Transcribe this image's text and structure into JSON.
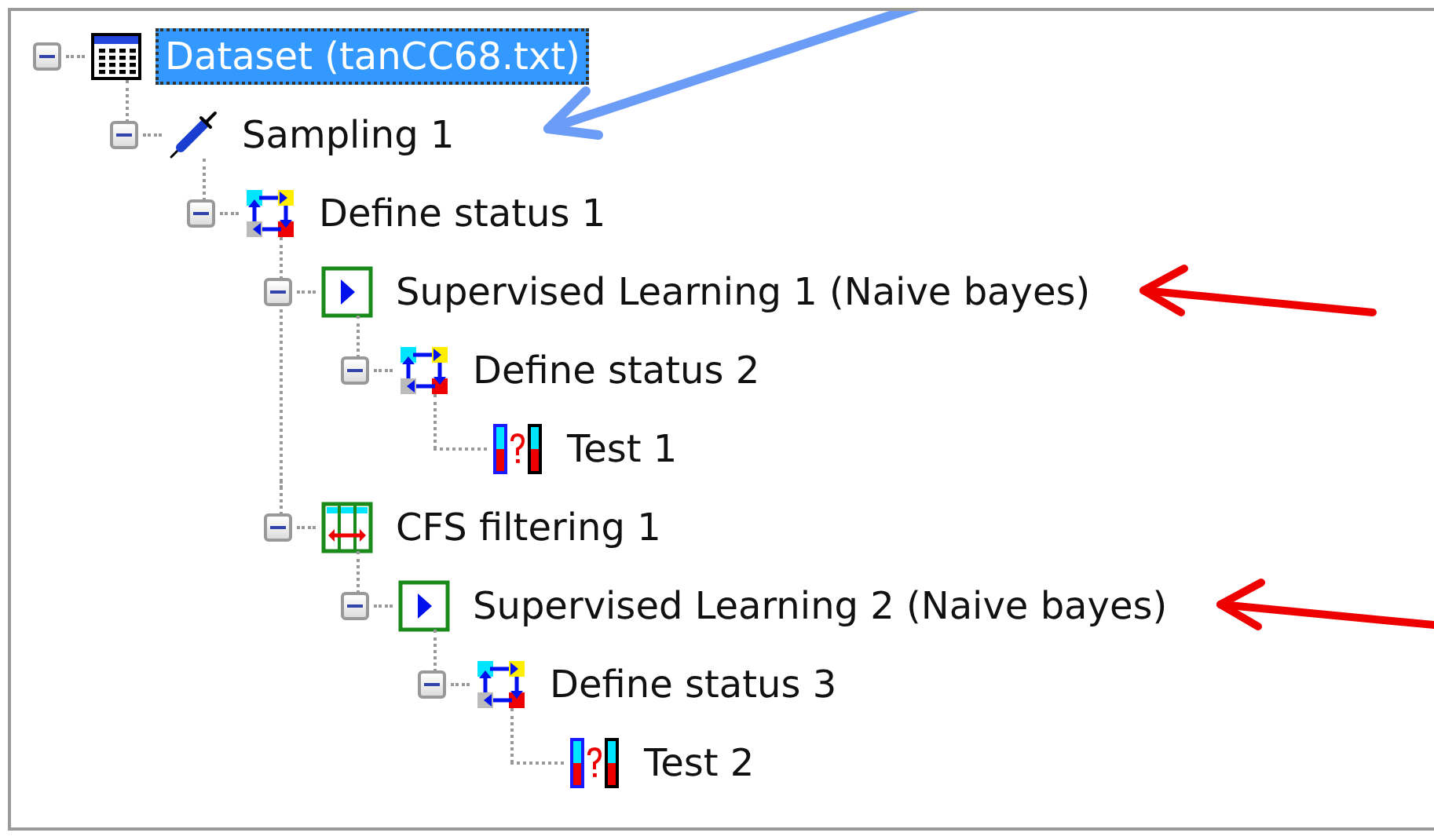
{
  "tree": [
    {
      "label": "Dataset (tanCC68.txt)",
      "kind": "dataset",
      "selected": true,
      "expanded": true,
      "children": [
        {
          "label": "Sampling 1",
          "kind": "sampling",
          "selected": false,
          "expanded": true,
          "pointer": {
            "color": "#6b9cf6",
            "kind": "from-above"
          },
          "children": [
            {
              "label": "Define status 1",
              "kind": "status",
              "selected": false,
              "expanded": true,
              "children": [
                {
                  "label": "Supervised Learning 1 (Naive bayes)",
                  "kind": "learning",
                  "selected": false,
                  "expanded": true,
                  "pointer": {
                    "color": "#ee0000",
                    "kind": "from-right"
                  },
                  "children": [
                    {
                      "label": "Define status 2",
                      "kind": "status",
                      "selected": false,
                      "expanded": true,
                      "children": [
                        {
                          "label": "Test 1",
                          "kind": "test",
                          "selected": false
                        }
                      ]
                    }
                  ]
                },
                {
                  "label": "CFS filtering 1",
                  "kind": "filter",
                  "selected": false,
                  "expanded": true,
                  "children": [
                    {
                      "label": "Supervised Learning 2 (Naive bayes)",
                      "kind": "learning",
                      "selected": false,
                      "expanded": true,
                      "pointer": {
                        "color": "#ee0000",
                        "kind": "from-right"
                      },
                      "children": [
                        {
                          "label": "Define status 3",
                          "kind": "status",
                          "selected": false,
                          "expanded": true,
                          "children": [
                            {
                              "label": "Test 2",
                              "kind": "test",
                              "selected": false
                            }
                          ]
                        }
                      ]
                    }
                  ]
                }
              ]
            }
          ]
        }
      ]
    }
  ]
}
